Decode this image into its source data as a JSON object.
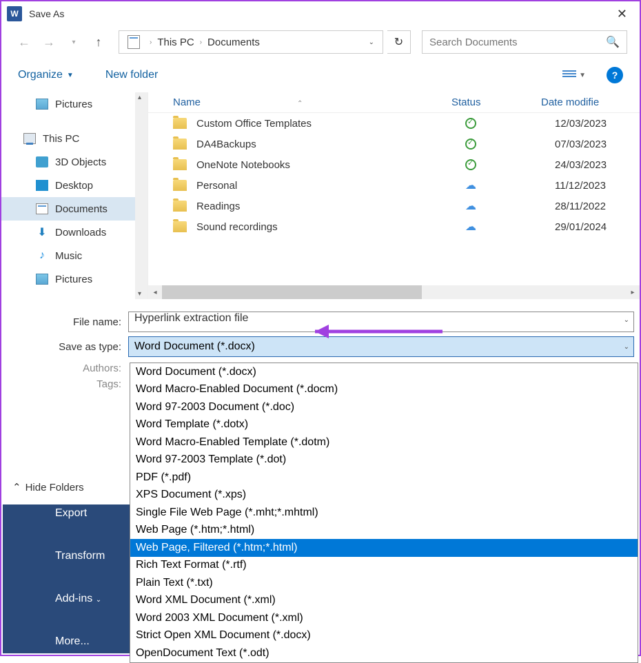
{
  "title": "Save As",
  "breadcrumb": {
    "root": "This PC",
    "folder": "Documents"
  },
  "search_placeholder": "Search Documents",
  "toolbar": {
    "organize": "Organize",
    "new_folder": "New folder"
  },
  "sidebar": {
    "items": [
      {
        "label": "Pictures"
      },
      {
        "label": "This PC"
      },
      {
        "label": "3D Objects"
      },
      {
        "label": "Desktop"
      },
      {
        "label": "Documents"
      },
      {
        "label": "Downloads"
      },
      {
        "label": "Music"
      },
      {
        "label": "Pictures"
      }
    ]
  },
  "columns": {
    "name": "Name",
    "status": "Status",
    "date": "Date modifie"
  },
  "files": [
    {
      "name": "Custom Office Templates",
      "status": "sync",
      "date": "12/03/2023"
    },
    {
      "name": "DA4Backups",
      "status": "sync",
      "date": "07/03/2023"
    },
    {
      "name": "OneNote Notebooks",
      "status": "sync",
      "date": "24/03/2023"
    },
    {
      "name": "Personal",
      "status": "cloud",
      "date": "11/12/2023"
    },
    {
      "name": "Readings",
      "status": "cloud",
      "date": "28/11/2022"
    },
    {
      "name": "Sound recordings",
      "status": "cloud",
      "date": "29/01/2024"
    }
  ],
  "form": {
    "file_name_label": "File name:",
    "file_name_value": "Hyperlink extraction file",
    "save_type_label": "Save as type:",
    "save_type_value": "Word Document (*.docx)",
    "authors_label": "Authors:",
    "tags_label": "Tags:"
  },
  "type_options": [
    "Word Document (*.docx)",
    "Word Macro-Enabled Document (*.docm)",
    "Word 97-2003 Document (*.doc)",
    "Word Template (*.dotx)",
    "Word Macro-Enabled Template (*.dotm)",
    "Word 97-2003 Template (*.dot)",
    "PDF (*.pdf)",
    "XPS Document (*.xps)",
    "Single File Web Page (*.mht;*.mhtml)",
    "Web Page (*.htm;*.html)",
    "Web Page, Filtered (*.htm;*.html)",
    "Rich Text Format (*.rtf)",
    "Plain Text (*.txt)",
    "Word XML Document (*.xml)",
    "Word 2003 XML Document (*.xml)",
    "Strict Open XML Document (*.docx)",
    "OpenDocument Text (*.odt)"
  ],
  "highlighted_option_index": 10,
  "hide_folders": "Hide Folders",
  "dark_menu": [
    "Export",
    "Transform",
    "Add-ins",
    "More..."
  ]
}
